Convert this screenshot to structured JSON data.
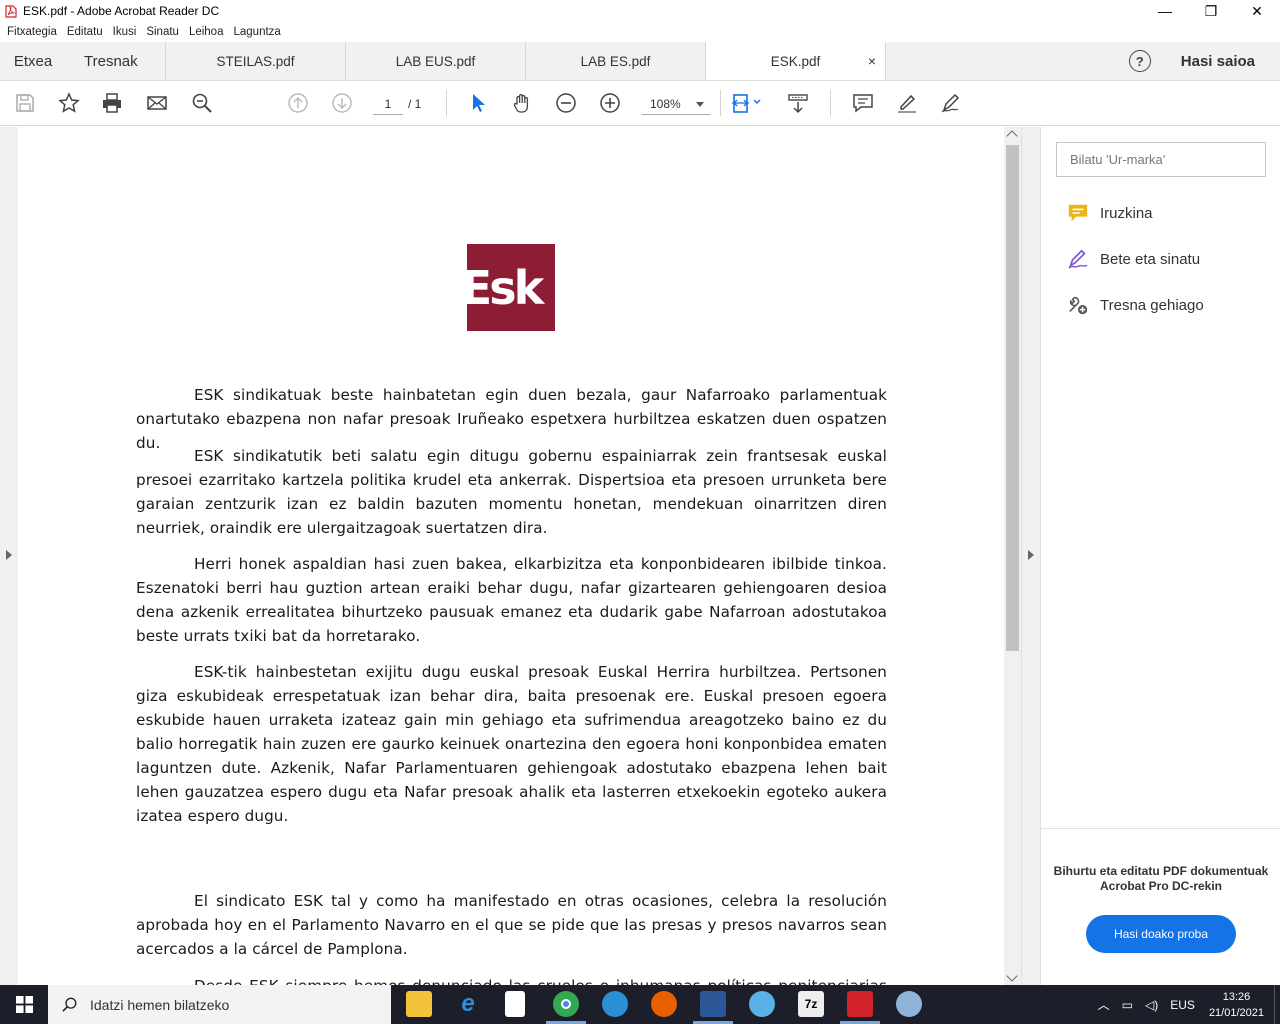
{
  "window": {
    "title": "ESK.pdf - Adobe Acrobat Reader DC",
    "controls": {
      "minimize": "—",
      "restore": "❐",
      "close": "✕"
    }
  },
  "menu": [
    "Fitxategia",
    "Editatu",
    "Ikusi",
    "Sinatu",
    "Leihoa",
    "Laguntza"
  ],
  "tabs": {
    "home": "Etxea",
    "tools": "Tresnak",
    "documents": [
      {
        "label": "STEILAS.pdf"
      },
      {
        "label": "LAB EUS.pdf"
      },
      {
        "label": "LAB ES.pdf"
      },
      {
        "label": "ESK.pdf",
        "active": true
      }
    ],
    "close_glyph": "×",
    "help_glyph": "?",
    "sign_in": "Hasi saioa"
  },
  "toolbar": {
    "page_current": "1",
    "page_total": "/ 1",
    "zoom": "108%"
  },
  "document": {
    "logo_text": "Esk",
    "paragraphs": [
      "ESK sindikatuak beste hainbatetan egin duen bezala, gaur Nafarroako parlamentuak onartutako ebazpena non nafar presoak Iruñeako espetxera hurbiltzea eskatzen duen ospatzen du.",
      "ESK sindikatutik beti salatu egin ditugu gobernu espainiarrak zein frantsesak euskal presoei ezarritako  kartzela politika krudel eta ankerrak. Dispertsioa eta presoen urrunketa bere garaian zentzurik izan ez baldin bazuten momentu honetan, mendekuan  oinarritzen diren neurriek, oraindik ere ulergaitzagoak suertatzen dira.",
      "Herri honek aspaldian hasi zuen bakea, elkarbizitza eta konponbidearen ibilbide tinkoa. Eszenatoki berri hau guztion artean eraiki behar dugu, nafar gizartearen gehiengoaren desioa dena azkenik errealitatea bihurtzeko pausuak emanez eta dudarik gabe Nafarroan adostutakoa beste urrats txiki bat da horretarako.",
      "ESK-tik hainbestetan exijitu dugu euskal presoak Euskal Herrira hurbiltzea. Pertsonen giza eskubideak errespetatuak izan behar dira, baita presoenak ere. Euskal presoen egoera eskubide hauen urraketa izateaz gain min gehiago eta sufrimendua areagotzeko baino ez du balio horregatik hain zuzen ere gaurko keinuek onartezina den egoera honi konponbidea ematen laguntzen dute. Azkenik, Nafar Parlamentuaren gehiengoak adostutako ebazpena lehen bait lehen gauzatzea espero dugu eta Nafar presoak ahalik eta lasterren etxekoekin egoteko aukera izatea espero dugu.",
      "El sindicato ESK tal y como ha manifestado en otras ocasiones, celebra la resolución aprobada hoy en el Parlamento Navarro en el que se pide que las presas y presos navarros sean acercados a la cárcel de Pamplona.",
      "Desde ESK siempre hemos denunciado las crueles e inhumanas políticas penitenciarias impuestas"
    ]
  },
  "right_panel": {
    "search_placeholder": "Bilatu 'Ur-marka'",
    "items": [
      {
        "label": "Iruzkina",
        "icon": "comment-icon"
      },
      {
        "label": "Bete eta sinatu",
        "icon": "fill-sign-icon"
      },
      {
        "label": "Tresna gehiago",
        "icon": "more-tools-icon"
      }
    ],
    "promo": "Bihurtu eta editatu PDF dokumentuak Acrobat Pro DC-rekin",
    "trial_button": "Hasi doako proba"
  },
  "taskbar": {
    "search_text": "Idatzi hemen bilatzeko",
    "language": "EUS",
    "time": "13:26",
    "date": "21/01/2021"
  },
  "colors": {
    "accent_blue": "#1473e6",
    "logo_red": "#8c1d35",
    "comment_yellow": "#e8b51f",
    "sign_purple": "#7b4fd6"
  }
}
